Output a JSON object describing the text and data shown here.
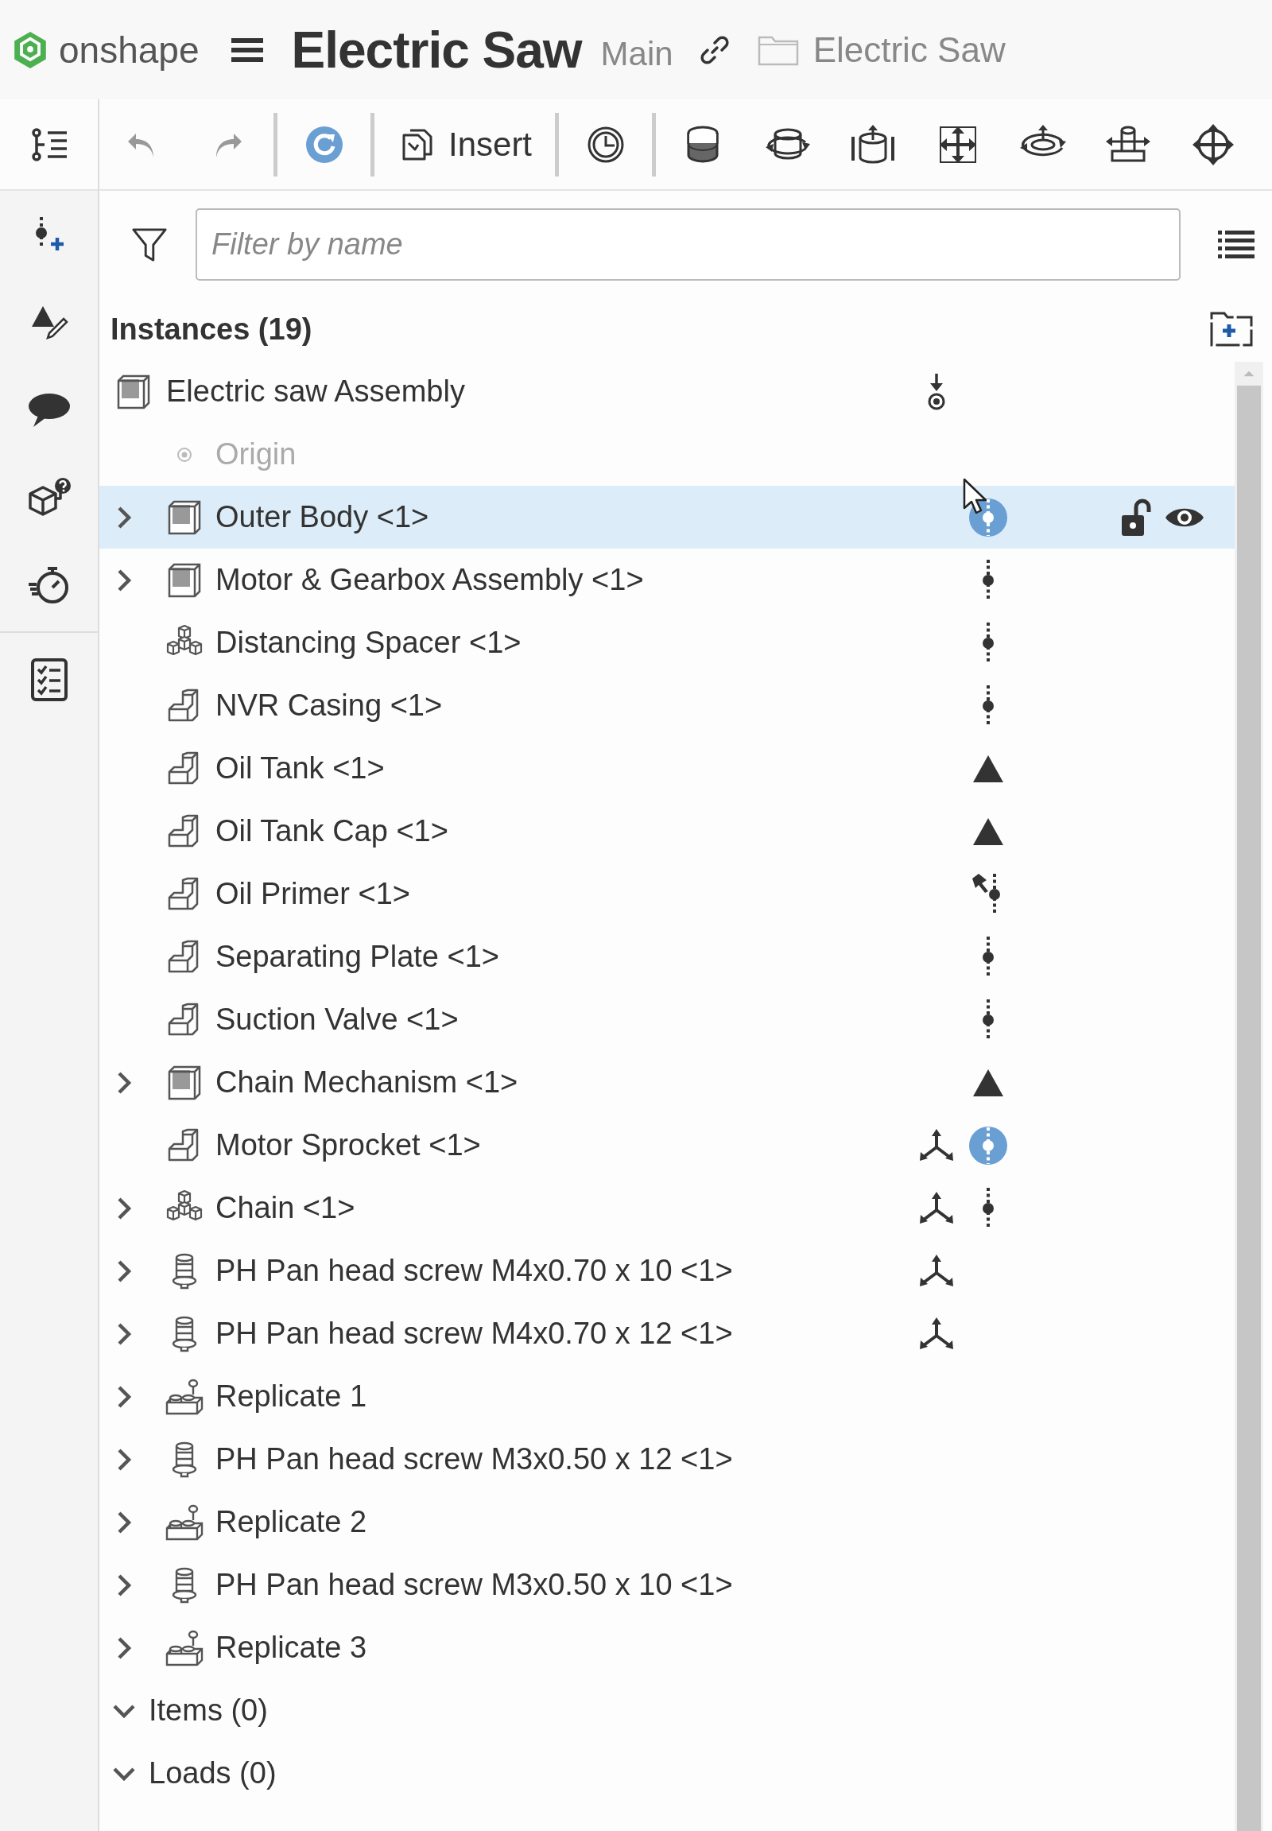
{
  "header": {
    "brand": "onshape",
    "document_title": "Electric Saw",
    "workspace": "Main",
    "folder": "Electric Saw"
  },
  "rail": [
    {
      "kind": "feature_list",
      "selected": true
    },
    {
      "kind": "mate_connector",
      "selected": false
    },
    {
      "kind": "sketch",
      "selected": false
    },
    {
      "kind": "comments",
      "selected": false
    },
    {
      "kind": "cube_help",
      "selected": false
    },
    {
      "kind": "stopwatch",
      "selected": false
    },
    {
      "kind": "checklist",
      "selected": false
    }
  ],
  "toolbar": [
    {
      "kind": "undo"
    },
    {
      "kind": "redo"
    },
    {
      "kind": "separator"
    },
    {
      "kind": "regenerate"
    },
    {
      "kind": "separator"
    },
    {
      "kind": "insert",
      "label": "Insert"
    },
    {
      "kind": "separator"
    },
    {
      "kind": "clock"
    },
    {
      "kind": "separator"
    },
    {
      "kind": "cylinder"
    },
    {
      "kind": "cylinder_rotate"
    },
    {
      "kind": "cylinder_lift"
    },
    {
      "kind": "move_cross"
    },
    {
      "kind": "orbit"
    },
    {
      "kind": "pin_slide"
    },
    {
      "kind": "globe_arrows"
    }
  ],
  "filter": {
    "placeholder": "Filter by name"
  },
  "instances": {
    "heading": "Instances (19)",
    "tree": [
      {
        "label": "Electric saw Assembly",
        "kind": "assembly",
        "selected": false,
        "grounded": true,
        "children": [
          {
            "label": "Origin",
            "kind": "origin",
            "selected": false
          },
          {
            "label": "Outer Body <1>",
            "kind": "assembly",
            "expanded": false,
            "selected": true,
            "status": {
              "kind": "free",
              "highlighted": true
            },
            "locked": false,
            "visible": true
          },
          {
            "label": "Motor & Gearbox Assembly <1>",
            "kind": "assembly",
            "expanded": false,
            "selected": false,
            "status": {
              "kind": "free",
              "highlighted": false
            }
          },
          {
            "label": "Distancing Spacer <1>",
            "kind": "composite",
            "selected": false,
            "status": {
              "kind": "free",
              "highlighted": false
            }
          },
          {
            "label": "NVR Casing <1>",
            "kind": "part",
            "selected": false,
            "status": {
              "kind": "free",
              "highlighted": false
            }
          },
          {
            "label": "Oil Tank <1>",
            "kind": "part",
            "selected": false,
            "status": {
              "kind": "fixed",
              "highlighted": false
            }
          },
          {
            "label": "Oil Tank Cap <1>",
            "kind": "part",
            "selected": false,
            "status": {
              "kind": "fixed",
              "highlighted": false
            }
          },
          {
            "label": "Oil Primer <1>",
            "kind": "part",
            "selected": false,
            "status": {
              "kind": "pinned",
              "highlighted": false
            }
          },
          {
            "label": "Separating Plate <1>",
            "kind": "part",
            "selected": false,
            "status": {
              "kind": "free",
              "highlighted": false
            }
          },
          {
            "label": "Suction Valve <1>",
            "kind": "part",
            "selected": false,
            "status": {
              "kind": "free",
              "highlighted": false
            }
          },
          {
            "label": "Chain Mechanism <1>",
            "kind": "assembly",
            "expanded": false,
            "selected": false,
            "status": {
              "kind": "fixed",
              "highlighted": false
            }
          },
          {
            "label": "Motor Sprocket <1>",
            "kind": "part",
            "selected": false,
            "mate_connector": true,
            "status": {
              "kind": "free",
              "highlighted": true
            }
          },
          {
            "label": "Chain <1>",
            "kind": "composite",
            "expanded": false,
            "selected": false,
            "mate_connector": true,
            "status": {
              "kind": "free",
              "highlighted": false
            }
          },
          {
            "label": "PH Pan head screw M4x0.70 x 10 <1>",
            "kind": "screw",
            "expanded": false,
            "selected": false,
            "mate_connector": true
          },
          {
            "label": "PH Pan head screw M4x0.70 x 12 <1>",
            "kind": "screw",
            "expanded": false,
            "selected": false,
            "mate_connector": true
          },
          {
            "label": "Replicate 1",
            "kind": "replicate",
            "expanded": false,
            "selected": false
          },
          {
            "label": "PH Pan head screw M3x0.50 x 12 <1>",
            "kind": "screw",
            "expanded": false,
            "selected": false
          },
          {
            "label": "Replicate 2",
            "kind": "replicate",
            "expanded": false,
            "selected": false
          },
          {
            "label": "PH Pan head screw M3x0.50 x 10 <1>",
            "kind": "screw",
            "expanded": false,
            "selected": false
          },
          {
            "label": "Replicate 3",
            "kind": "replicate",
            "expanded": false,
            "selected": false
          }
        ]
      }
    ]
  },
  "sections": [
    {
      "label": "Items (0)",
      "expanded": true
    },
    {
      "label": "Loads (0)",
      "expanded": true
    }
  ]
}
